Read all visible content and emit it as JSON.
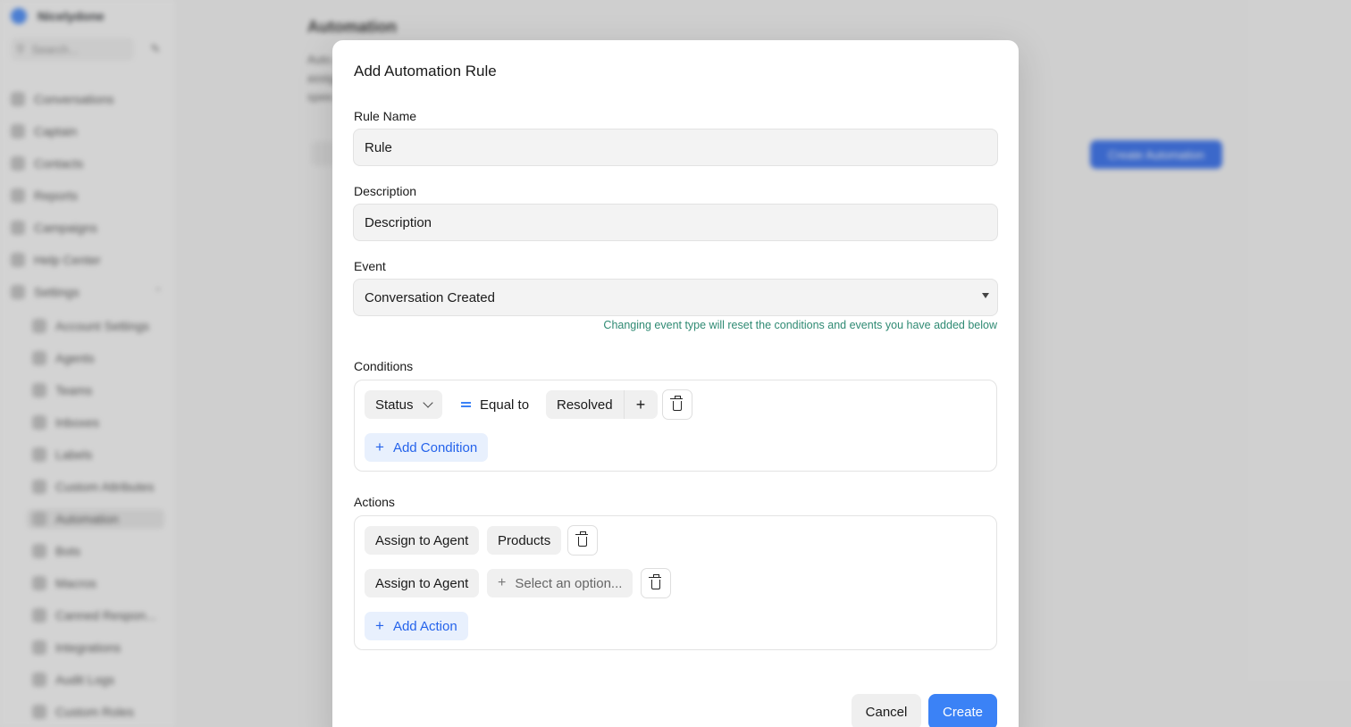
{
  "sidebar": {
    "brand": "Nicelydone",
    "search_placeholder": "Search...",
    "items": [
      {
        "label": "Conversations"
      },
      {
        "label": "Captain"
      },
      {
        "label": "Contacts"
      },
      {
        "label": "Reports"
      },
      {
        "label": "Campaigns"
      },
      {
        "label": "Help Center"
      },
      {
        "label": "Settings"
      }
    ],
    "settings_items": [
      {
        "label": "Account Settings"
      },
      {
        "label": "Agents"
      },
      {
        "label": "Teams"
      },
      {
        "label": "Inboxes"
      },
      {
        "label": "Labels"
      },
      {
        "label": "Custom Attributes"
      },
      {
        "label": "Automation"
      },
      {
        "label": "Bots"
      },
      {
        "label": "Macros"
      },
      {
        "label": "Canned Respon..."
      },
      {
        "label": "Integrations"
      },
      {
        "label": "Audit Logs"
      },
      {
        "label": "Custom Roles"
      }
    ]
  },
  "page": {
    "title": "Automation",
    "description": "Auto... assig... spee...",
    "create_button": "Create Automation"
  },
  "modal": {
    "title": "Add Automation Rule",
    "rule_name": {
      "label": "Rule Name",
      "value": "Rule"
    },
    "description": {
      "label": "Description",
      "value": "Description"
    },
    "event": {
      "label": "Event",
      "selected": "Conversation Created",
      "hint": "Changing event type will reset the conditions and events you have added below"
    },
    "conditions": {
      "label": "Conditions",
      "rows": [
        {
          "attribute": "Status",
          "operator": "Equal to",
          "value": "Resolved"
        }
      ],
      "add_label": "Add Condition"
    },
    "actions": {
      "label": "Actions",
      "rows": [
        {
          "type": "Assign to Agent",
          "value": "Products"
        },
        {
          "type": "Assign to Agent",
          "placeholder": "Select an option..."
        }
      ],
      "add_label": "Add Action"
    },
    "cancel_label": "Cancel",
    "create_label": "Create"
  },
  "colors": {
    "accent": "#3b82f6",
    "hint": "#2f8a73",
    "chip_bg": "#f0f0f0"
  }
}
